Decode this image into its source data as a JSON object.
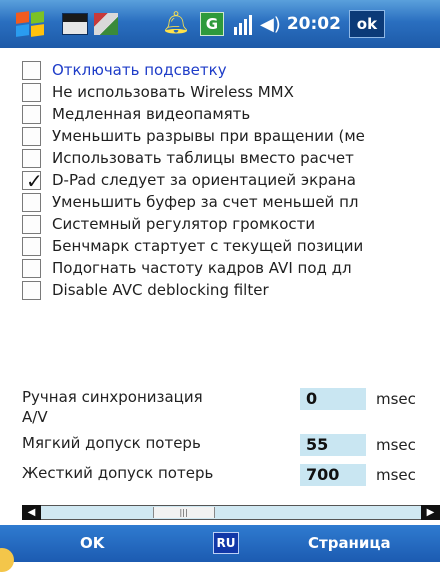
{
  "taskbar": {
    "time": "20:02",
    "ok_label": "ok",
    "notification_icon": "alarm-bell-icon",
    "g_label": "G",
    "volume_icon": "◀€"
  },
  "checkboxes": [
    {
      "label": "Отключать подсветку",
      "checked": false,
      "highlight": true
    },
    {
      "label": "Не использовать Wireless MMX",
      "checked": false
    },
    {
      "label": "Медленная видеопамять",
      "checked": false
    },
    {
      "label": "Уменьшить разрывы при вращении (ме",
      "checked": false
    },
    {
      "label": "Использовать таблицы вместо расчет",
      "checked": false
    },
    {
      "label": "D-Pad следует за ориентацией экрана",
      "checked": true
    },
    {
      "label": "Уменьшить буфер за счет меньшей пл",
      "checked": false
    },
    {
      "label": "Системный регулятор громкости",
      "checked": false
    },
    {
      "label": "Бенчмарк стартует с текущей позиции",
      "checked": false
    },
    {
      "label": "Подогнать частоту кадров AVI под дл",
      "checked": false
    },
    {
      "label": "Disable AVC deblocking filter",
      "checked": false
    }
  ],
  "sync": {
    "manual_label": "Ручная синхронизация",
    "manual_label2": "A/V",
    "manual_value": "0",
    "soft_label": "Мягкий допуск потерь",
    "soft_value": "55",
    "hard_label": "Жесткий допуск потерь",
    "hard_value": "700",
    "unit": "msec"
  },
  "scrollbar": {
    "position": 0.35
  },
  "menubar": {
    "left_label": "OK",
    "mid_label": "RU",
    "right_label": "Страница"
  },
  "colors": {
    "taskbar": "#2a6fc0",
    "field": "#c9e6f2",
    "highlight_text": "#1e3cc8"
  }
}
